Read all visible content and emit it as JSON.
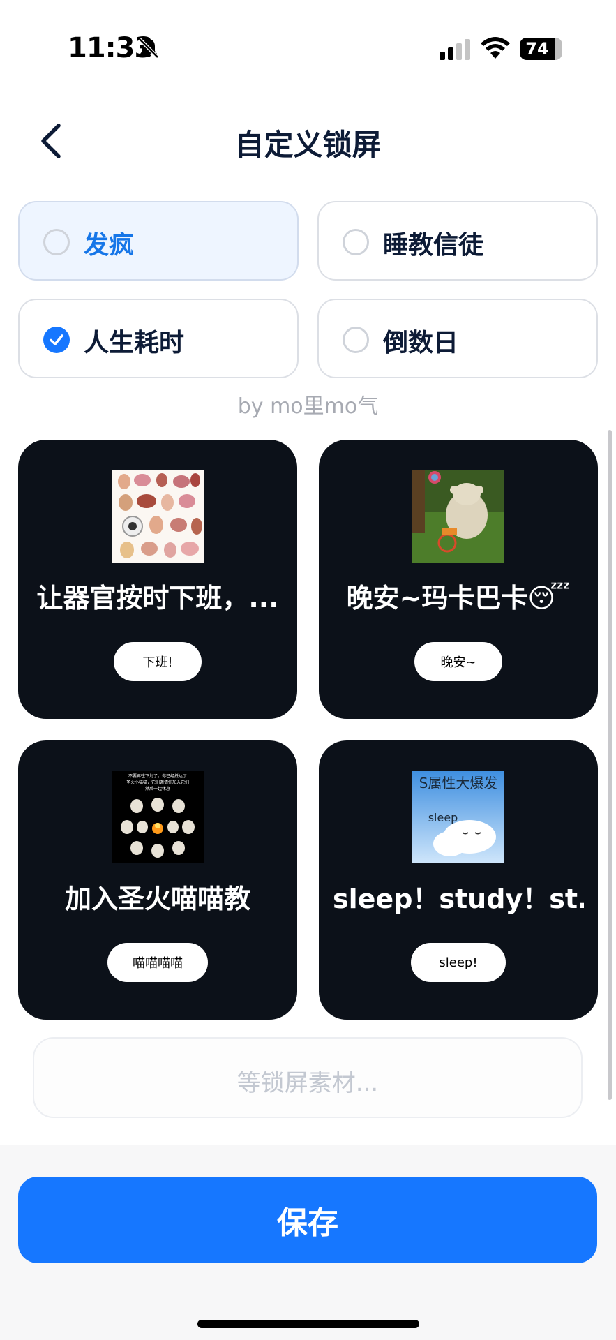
{
  "status_bar": {
    "time": "11:33",
    "battery": "74",
    "icons": [
      "bell-slash-icon",
      "cellular-signal-icon",
      "wifi-icon",
      "battery-icon"
    ]
  },
  "header": {
    "title": "自定义锁屏",
    "back_icon": "chevron-left-icon"
  },
  "options": [
    {
      "label": "发疯",
      "selected": false,
      "highlighted": true
    },
    {
      "label": "睡教信徒",
      "selected": false,
      "highlighted": false
    },
    {
      "label": "人生耗时",
      "selected": true,
      "highlighted": false
    },
    {
      "label": "倒数日",
      "selected": false,
      "highlighted": false
    }
  ],
  "credit": "by mo里mo气",
  "cards": [
    {
      "title": "让器官按时下班，...",
      "button": "下班!",
      "image": "organs-illustration"
    },
    {
      "title": "晚安~玛卡巴卡😴",
      "button": "晚安~",
      "image": "makka-pakka-on-tricycle"
    },
    {
      "title": "加入圣火喵喵教",
      "button": "喵喵喵喵",
      "image": "cats-around-fire",
      "image_caption": "不要再往下划了，你已经抵达了\n圣火小猫猫，它们邀请你加入它们\n然后一起休息"
    },
    {
      "title": "sleep！study！st...",
      "button": "sleep!",
      "image": "sleepy-cloud",
      "image_caption": "S属性大爆发",
      "image_sub": "sleep"
    }
  ],
  "placeholder": "等锁屏素材...",
  "save_button": "保存",
  "colors": {
    "accent": "#1677ff",
    "card_bg": "#0c1119",
    "title": "#0d1b36"
  }
}
